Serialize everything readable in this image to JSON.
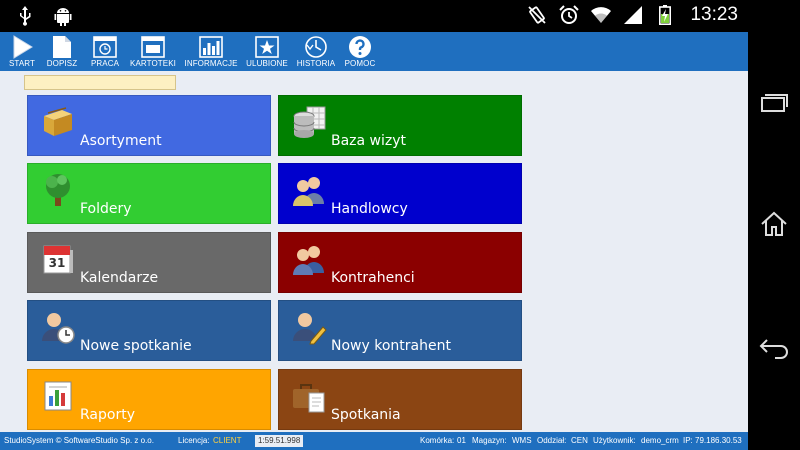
{
  "statusbar": {
    "time": "13:23",
    "icons": [
      "usb-icon",
      "android-icon",
      "no-rotate-icon",
      "alarm-icon",
      "wifi-icon",
      "signal-icon",
      "battery-icon"
    ]
  },
  "toolbar": {
    "items": [
      {
        "label": "START",
        "icon": "play-icon"
      },
      {
        "label": "DOPISZ",
        "icon": "document-icon"
      },
      {
        "label": "PRACA",
        "icon": "clock-window-icon"
      },
      {
        "label": "KARTOTEKI",
        "icon": "folder-window-icon"
      },
      {
        "label": "INFORMACJE",
        "icon": "bar-chart-icon"
      },
      {
        "label": "ULUBIONE",
        "icon": "star-icon"
      },
      {
        "label": "HISTORIA",
        "icon": "history-icon"
      },
      {
        "label": "POMOC",
        "icon": "help-icon"
      }
    ]
  },
  "search": {
    "value": "",
    "placeholder": ""
  },
  "tiles": [
    {
      "label": "Asortyment",
      "color": "#4169e1",
      "icon": "box-icon"
    },
    {
      "label": "Baza wizyt",
      "color": "#008000",
      "icon": "database-icon"
    },
    {
      "label": "Foldery",
      "color": "#32cd32",
      "icon": "tree-icon"
    },
    {
      "label": "Handlowcy",
      "color": "#0000cd",
      "icon": "users-icon"
    },
    {
      "label": "Kalendarze",
      "color": "#696969",
      "icon": "calendar-icon"
    },
    {
      "label": "Kontrahenci",
      "color": "#8b0000",
      "icon": "contacts-icon"
    },
    {
      "label": "Nowe spotkanie",
      "color": "#2a5d9a",
      "icon": "user-clock-icon"
    },
    {
      "label": "Nowy kontrahent",
      "color": "#2a5d9a",
      "icon": "user-pencil-icon"
    },
    {
      "label": "Raporty",
      "color": "#ffa500",
      "icon": "report-chart-icon"
    },
    {
      "label": "Spotkania",
      "color": "#8b4513",
      "icon": "briefcase-icon"
    }
  ],
  "footer": {
    "copyright": "StudioSystem © SoftwareStudio Sp. z o.o.",
    "license_label": "Licencja:",
    "license_value": "CLIENT",
    "timer": "1:59.51.998",
    "komorka_label": "Komórka:",
    "komorka_value": "01",
    "magazyn_label": "Magazyn:",
    "magazyn_value": "WMS",
    "oddzial_label": "Oddział:",
    "oddzial_value": "CEN",
    "user_label": "Użytkownik:",
    "user_value": "demo_crm",
    "ip_label": "IP:",
    "ip_value": "79.186.30.53"
  },
  "colors": {
    "toolbar_bg": "#1f6fbf",
    "app_bg": "#e9edf4",
    "search_bg": "#fdf0c2",
    "highlight": "#ffd23f"
  }
}
